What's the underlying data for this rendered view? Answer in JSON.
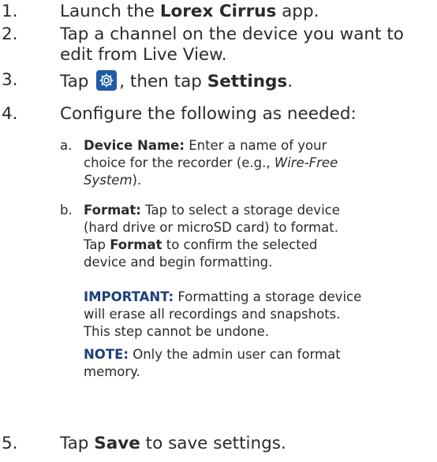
{
  "steps": [
    {
      "num": "1.",
      "pre": "Launch the ",
      "bold": "Lorex Cirrus",
      "post": " app."
    },
    {
      "num": "2.",
      "line1": "Tap a channel on the device you want to",
      "line2": "edit from Live View."
    },
    {
      "num": "3.",
      "pre": "Tap ",
      "mid": ", then tap ",
      "bold": "Settings",
      "post": "."
    },
    {
      "num": "4.",
      "text": "Configure the following as needed:"
    },
    {
      "num": "5.",
      "pre": "Tap ",
      "bold": "Save",
      "post": " to save settings."
    }
  ],
  "sub": [
    {
      "letter": "a.",
      "label": "Device Name:",
      "line1": " Enter a name of your",
      "line2": "choice for the recorder (e.g., ",
      "italic_a": "Wire-Free",
      "italic_b": "System",
      "line3_post": ")."
    },
    {
      "letter": "b.",
      "label": "Format:",
      "line1": " Tap to select a storage device",
      "line2": "(hard drive or microSD card) to format.",
      "line3_pre": "Tap ",
      "line3_bold": "Format",
      "line3_post": " to confirm the selected",
      "line4": "device and begin formatting."
    }
  ],
  "important": {
    "label": "IMPORTANT:",
    "line1": " Formatting a storage device",
    "line2": "will erase all recordings and snapshots.",
    "line3": "This step cannot be undone."
  },
  "note": {
    "label": "NOTE:",
    "line1": " Only the admin user can format",
    "line2": "memory."
  },
  "colors": {
    "accent": "#1f3f7a",
    "icon_bg": "#1f5ca8",
    "text": "#2b2b2b"
  },
  "icons": {
    "settings": "gear-icon"
  }
}
